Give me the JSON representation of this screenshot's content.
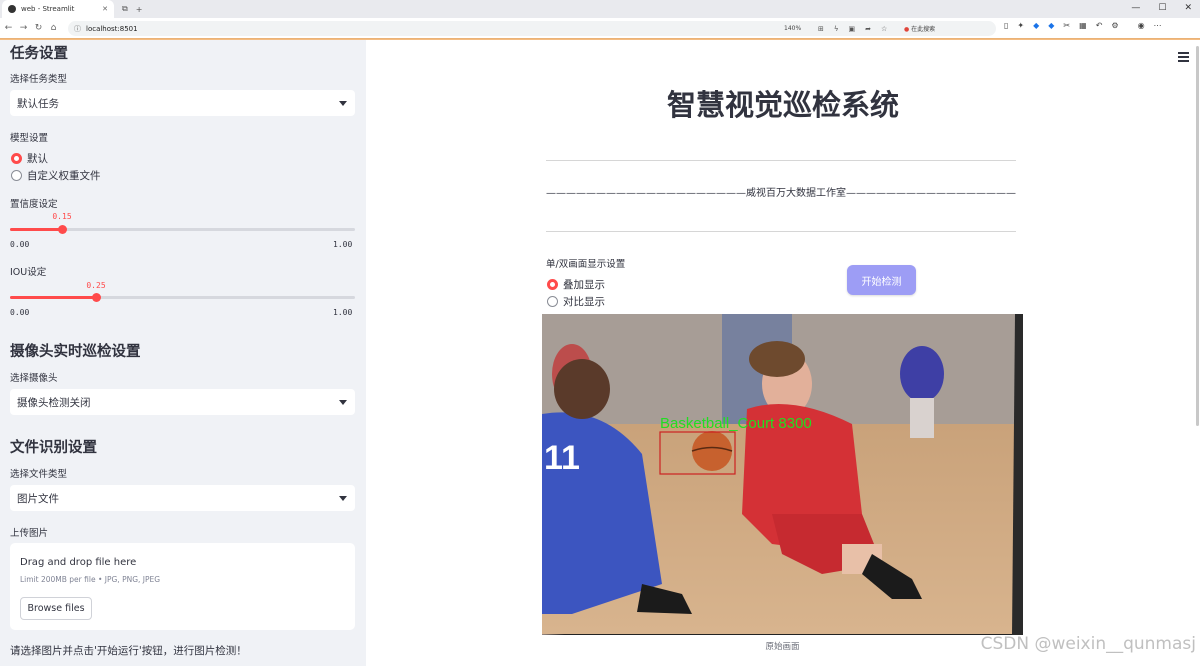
{
  "browser": {
    "tab_title": "web - Streamlit",
    "url": "localhost:8501",
    "zoom": "140%",
    "search_placeholder": "在此搜索"
  },
  "sidebar": {
    "task_header": "任务设置",
    "task_type_label": "选择任务类型",
    "task_type_value": "默认任务",
    "model_label": "模型设置",
    "model_options": [
      "默认",
      "自定义权重文件"
    ],
    "model_selected": 0,
    "conf_label": "置信度设定",
    "conf": {
      "value": "0.15",
      "min": "0.00",
      "max": "1.00"
    },
    "iou_label": "IOU设定",
    "iou": {
      "value": "0.25",
      "min": "0.00",
      "max": "1.00"
    },
    "camera_header": "摄像头实时巡检设置",
    "camera_label": "选择摄像头",
    "camera_value": "摄像头检测关闭",
    "file_header": "文件识别设置",
    "file_type_label": "选择文件类型",
    "file_type_value": "图片文件",
    "upload_label": "上传图片",
    "upload_main": "Drag and drop file here",
    "upload_sub": "Limit 200MB per file • JPG, PNG, JPEG",
    "browse_label": "Browse files",
    "footer_text": "请选择图片并点击'开始运行'按钮，进行图片检测！"
  },
  "main": {
    "title": "智慧视觉巡检系统",
    "subline": "————————————————————威视百万大数据工作室———————————————————————",
    "display_label": "单/双画面显示设置",
    "display_options": [
      "叠加显示",
      "对比显示"
    ],
    "display_selected": 0,
    "start_button": "开始检测",
    "detection_label": "Basketball_Court  8300",
    "caption": "原始画面"
  },
  "watermark": "CSDN @weixin__qunmasj",
  "colors": {
    "accent": "#ff4b4b",
    "button": "#9d9df5",
    "sidebar_bg": "#f0f2f6",
    "detect_text": "#22dd22",
    "detect_box": "#cc2222"
  }
}
